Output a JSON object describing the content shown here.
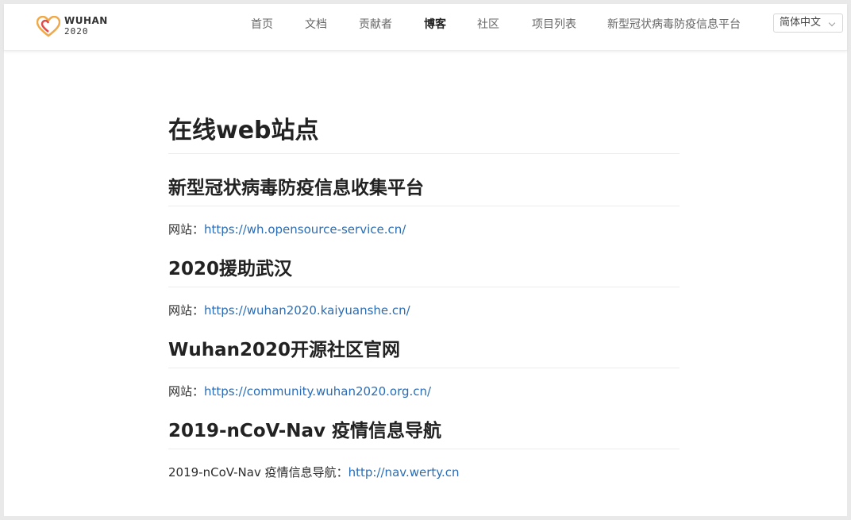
{
  "brand": {
    "name": "WUHAN",
    "year": "2020",
    "colors": {
      "heart_orange": "#f0a94a",
      "heart_red": "#e04a4a"
    }
  },
  "nav": {
    "items": [
      {
        "label": "首页"
      },
      {
        "label": "文档"
      },
      {
        "label": "贡献者"
      },
      {
        "label": "博客",
        "active": true
      },
      {
        "label": "社区"
      },
      {
        "label": "项目列表"
      },
      {
        "label": "新型冠状病毒防疫信息平台"
      }
    ],
    "language": {
      "selected": "简体中文"
    }
  },
  "page": {
    "title": "在线web站点",
    "sections": [
      {
        "heading": "新型冠状病毒防疫信息收集平台",
        "prefix": "网站：",
        "link": "https://wh.opensource-service.cn/"
      },
      {
        "heading": "2020援助武汉",
        "prefix": "网站：",
        "link": "https://wuhan2020.kaiyuanshe.cn/"
      },
      {
        "heading": "Wuhan2020开源社区官网",
        "prefix": "网站：",
        "link": "https://community.wuhan2020.org.cn/"
      },
      {
        "heading": "2019-nCoV-Nav 疫情信息导航",
        "prefix": "2019-nCoV-Nav 疫情信息导航：",
        "link": "http://nav.werty.cn"
      }
    ]
  },
  "theme": {
    "link_color": "#2a6db6",
    "text_color": "#2c2c2c",
    "divider_color": "#eaecef"
  }
}
